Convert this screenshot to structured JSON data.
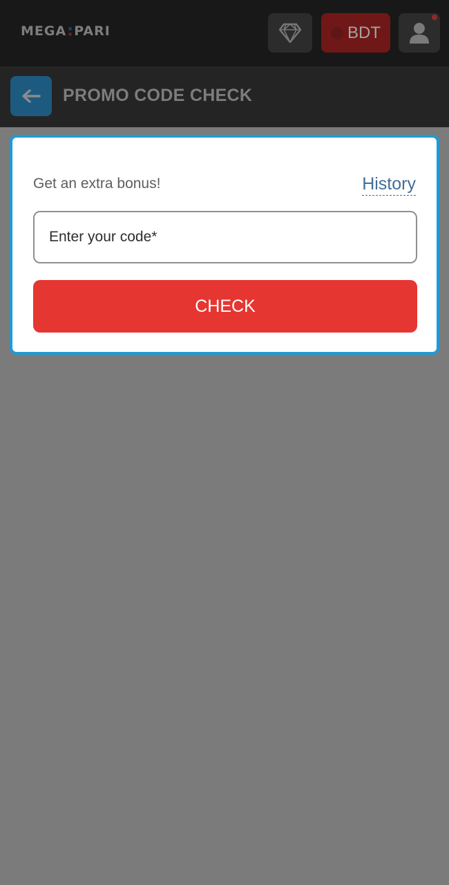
{
  "header": {
    "logo_left": "MEGA",
    "logo_right": "PARI",
    "currency_label": "BDT",
    "icons": {
      "gem": "diamond-icon",
      "user": "user-icon"
    },
    "colors": {
      "currency_button": "#701717",
      "notification_dot": "#8f2a2a"
    }
  },
  "subheader": {
    "title": "PROMO CODE CHECK",
    "back_icon": "arrow-left-icon",
    "back_button_color": "#1d5a80"
  },
  "promo_card": {
    "bonus_text": "Get an extra bonus!",
    "history_link": "History",
    "input_placeholder": "Enter your code*",
    "input_value": "",
    "check_button": "CHECK",
    "colors": {
      "border": "#1e9bd7",
      "check_button": "#e63631",
      "link": "#416e95"
    }
  }
}
